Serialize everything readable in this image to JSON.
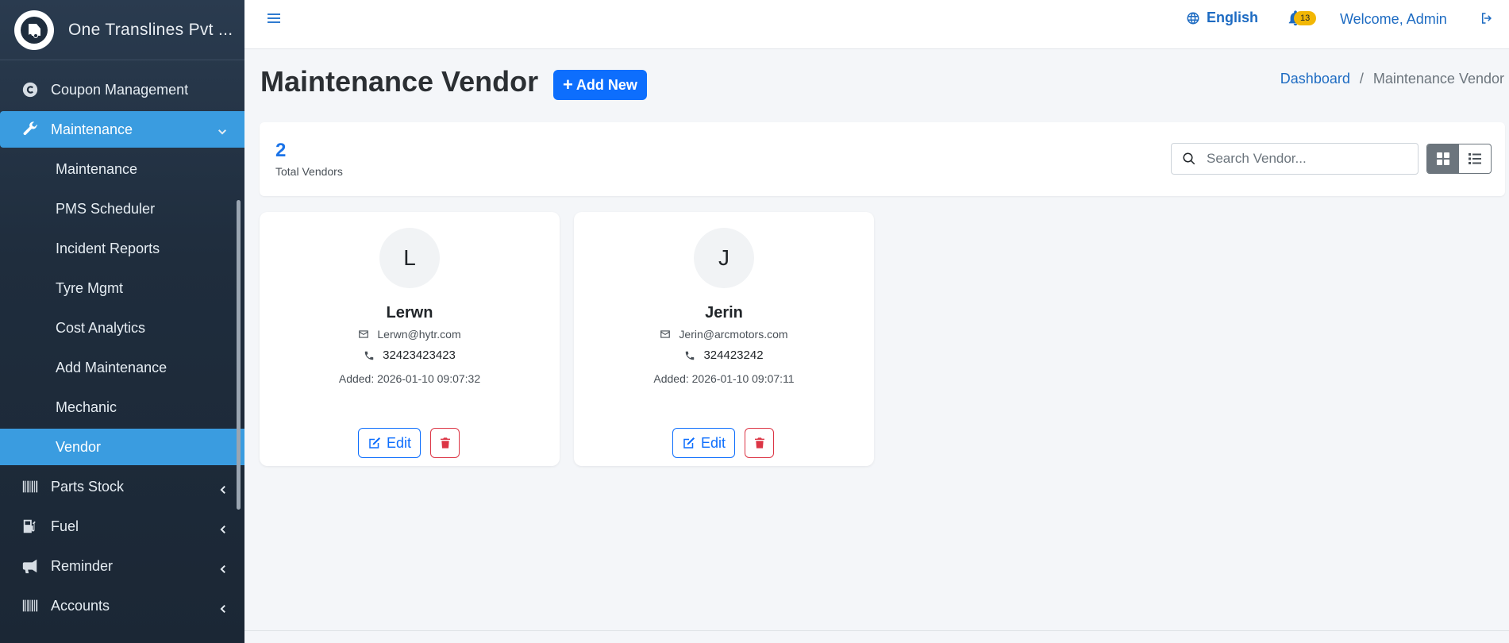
{
  "app": {
    "brand": "One Translines Pvt ..."
  },
  "sidebar": {
    "items": [
      {
        "label": "Coupon Management",
        "icon": "coupon-icon"
      },
      {
        "label": "Maintenance",
        "icon": "wrench-icon"
      }
    ],
    "maintenance_sub": [
      "Maintenance",
      "PMS Scheduler",
      "Incident Reports",
      "Tyre Mgmt",
      "Cost Analytics",
      "Add Maintenance",
      "Mechanic",
      "Vendor"
    ],
    "lower_items": [
      {
        "label": "Parts Stock",
        "icon": "barcode-icon"
      },
      {
        "label": "Fuel",
        "icon": "gas-pump-icon"
      },
      {
        "label": "Reminder",
        "icon": "megaphone-icon"
      },
      {
        "label": "Accounts",
        "icon": "barcode-icon"
      }
    ],
    "active_sub": "Vendor"
  },
  "topbar": {
    "language": "English",
    "notification_count": "13",
    "welcome": "Welcome, Admin"
  },
  "page": {
    "title": "Maintenance Vendor",
    "add_label": "Add New",
    "breadcrumb": {
      "home": "Dashboard",
      "current": "Maintenance Vendor"
    }
  },
  "stats": {
    "count": "2",
    "label": "Total Vendors"
  },
  "search": {
    "placeholder": "Search Vendor..."
  },
  "vendors": [
    {
      "initial": "L",
      "name": "Lerwn",
      "email": "Lerwn@hytr.com",
      "phone": "32423423423",
      "added": "Added: 2026-01-10 09:07:32",
      "edit_label": "Edit"
    },
    {
      "initial": "J",
      "name": "Jerin",
      "email": "Jerin@arcmotors.com",
      "phone": "324423242",
      "added": "Added: 2026-01-10 09:07:11",
      "edit_label": "Edit"
    }
  ],
  "colors": {
    "sidebar_active": "#3a9ce0",
    "primary": "#0d6efd",
    "danger": "#dc3545",
    "badge": "#f2b705"
  }
}
